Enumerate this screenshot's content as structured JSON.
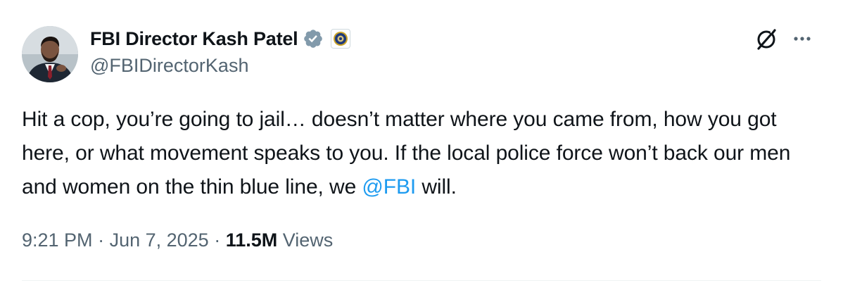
{
  "author": {
    "display_name": "FBI Director Kash Patel",
    "handle": "@FBIDirectorKash"
  },
  "icons": {
    "avatar": "avatar-photo",
    "verified": "verified-badge-icon",
    "affiliate": "fbi-seal-icon",
    "grok": "grok-icon",
    "more": "more-icon"
  },
  "tweet": {
    "text_before_mention": "Hit a cop, you’re going to jail… doesn’t matter where  you came from, how you got here, or what movement speaks to you. If the local police force won’t back our men and women on the thin blue line, we ",
    "mention": "@FBI",
    "text_after_mention": " will."
  },
  "meta": {
    "time": "9:21 PM",
    "separator": " · ",
    "date": "Jun 7, 2025",
    "views_count": "11.5M",
    "views_label": "Views"
  },
  "colors": {
    "text": "#0f1419",
    "secondary": "#536471",
    "accent": "#1d9bf0",
    "verified_gray": "#829aab"
  }
}
